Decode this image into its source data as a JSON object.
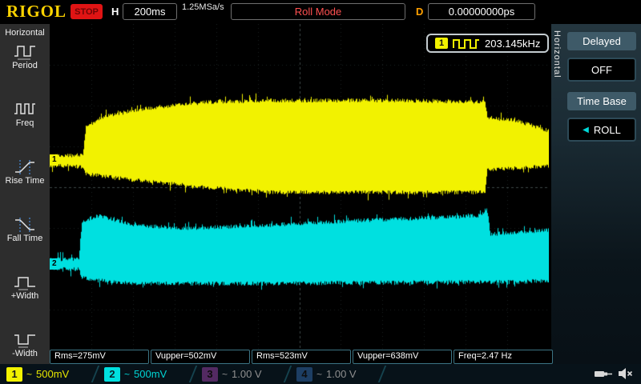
{
  "header": {
    "brand": "RIGOL",
    "run_state": "STOP",
    "h_label": "H",
    "timebase": "200ms",
    "sample_rate": "1.25MSa/s",
    "mode": "Roll Mode",
    "d_label": "D",
    "delay": "0.00000000ps"
  },
  "left_menu": {
    "title": "Horizontal",
    "items": [
      {
        "label": "Period"
      },
      {
        "label": "Freq"
      },
      {
        "label": "Rise Time"
      },
      {
        "label": "Fall Time"
      },
      {
        "label": "+Width"
      },
      {
        "label": "-Width"
      }
    ]
  },
  "scope": {
    "freq_badge": {
      "channel": "1",
      "value": "203.145kHz"
    },
    "ch1_marker": "1",
    "ch2_marker": "2"
  },
  "right_menu": {
    "side_label": "Horizontal",
    "delayed_title": "Delayed",
    "delayed_value": "OFF",
    "timebase_title": "Time Base",
    "timebase_value": "ROLL",
    "selected_arrow": "◀"
  },
  "measurements": [
    {
      "text": "Rms=275mV"
    },
    {
      "text": "Vupper=502mV"
    },
    {
      "text": "Rms=523mV"
    },
    {
      "text": "Vupper=638mV"
    },
    {
      "text": "Freq=2.47 Hz"
    }
  ],
  "channels": [
    {
      "num": "1",
      "coupling": "~",
      "scale": "500mV",
      "active": true
    },
    {
      "num": "2",
      "coupling": "~",
      "scale": "500mV",
      "active": true
    },
    {
      "num": "3",
      "coupling": "~",
      "scale": "1.00 V",
      "active": false
    },
    {
      "num": "4",
      "coupling": "~",
      "scale": "1.00 V",
      "active": false
    }
  ],
  "colors": {
    "ch1": "#f2f200",
    "ch2": "#00e0e0",
    "brand_yellow": "#ffd400",
    "stop_red": "#e01414",
    "roll_mode_text": "#ff5050"
  },
  "waveforms": [
    {
      "name": "channel-1",
      "color": "#f2f200",
      "noise": 5,
      "spike": 8,
      "points": [
        [
          0,
          168,
          174
        ],
        [
          41,
          166,
          176
        ],
        [
          45,
          130,
          185
        ],
        [
          68,
          118,
          188
        ],
        [
          118,
          108,
          194
        ],
        [
          198,
          100,
          202
        ],
        [
          278,
          98,
          208
        ],
        [
          438,
          98,
          208
        ],
        [
          543,
          100,
          208
        ],
        [
          546,
          120,
          180
        ],
        [
          578,
          122,
          178
        ],
        [
          623,
          136,
          175
        ]
      ]
    },
    {
      "name": "channel-2",
      "color": "#00e0e0",
      "noise": 5,
      "spike": 8,
      "points": [
        [
          0,
          297,
          303
        ],
        [
          36,
          296,
          304
        ],
        [
          40,
          250,
          314
        ],
        [
          58,
          242,
          318
        ],
        [
          108,
          254,
          322
        ],
        [
          168,
          258,
          322
        ],
        [
          268,
          254,
          322
        ],
        [
          388,
          248,
          321
        ],
        [
          538,
          242,
          320
        ],
        [
          545,
          232,
          320
        ],
        [
          550,
          265,
          320
        ],
        [
          588,
          263,
          320
        ],
        [
          623,
          260,
          318
        ]
      ]
    }
  ]
}
